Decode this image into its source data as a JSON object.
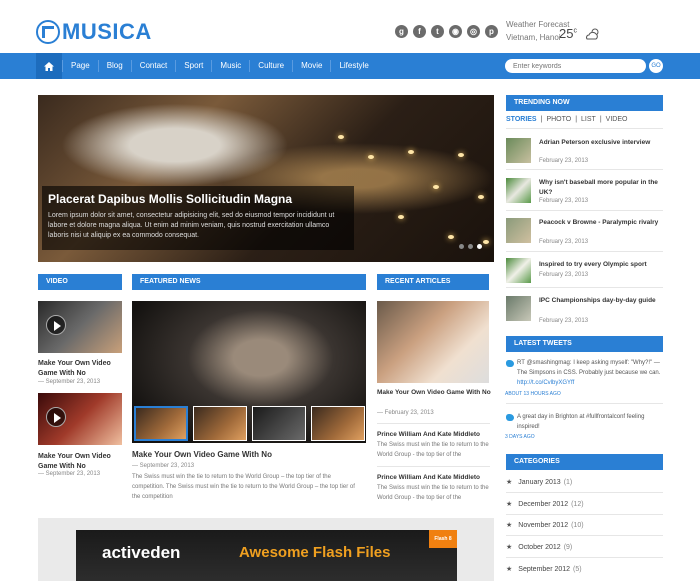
{
  "header": {
    "logo_text": "MUSICA",
    "social_icons": [
      "googleplus-icon",
      "facebook-icon",
      "twitter-icon",
      "rss-icon",
      "dribbble-icon",
      "pinterest-icon"
    ],
    "weather_label": "Weather Forecast",
    "weather_location": "Vietnam, Hanoi",
    "temperature": "25",
    "temperature_unit": "c"
  },
  "nav": {
    "items": [
      "Page",
      "Blog",
      "Contact",
      "Sport",
      "Music",
      "Culture",
      "Movie",
      "Lifestyle"
    ],
    "search_placeholder": "Enter keywords",
    "search_button": "GO"
  },
  "slider": {
    "title": "Placerat Dapibus Mollis Sollicitudin Magna",
    "description": "Lorem ipsum dolor sit amet, consectetur adipisicing elit, sed do eiusmod tempor incididunt ut labore et dolore magna aliqua. Ut enim ad minim veniam, quis nostrud exercitation ullamco laboris nisi ut aliquip ex ea commodo consequat.",
    "slide_count": 3,
    "active_slide": 3
  },
  "video": {
    "header": "VIDEO",
    "items": [
      {
        "title": "Make Your Own Video Game With No",
        "date": "— September 23, 2013"
      },
      {
        "title": "Make Your Own Video Game With No",
        "date": "— September 23, 2013"
      }
    ]
  },
  "featured": {
    "header": "FEATURED NEWS",
    "title": "Make Your Own Video Game With No",
    "date": "— September 23, 2013",
    "text": "The Swiss must win the tie to return to the World Group – the top tier of the competition. The Swiss must win the tie to return to the World Group – the top tier of the competition"
  },
  "recent": {
    "header": "RECENT ARTICLES",
    "items": [
      {
        "title": "Make Your Own Video Game With No",
        "date": "— February 23, 2013"
      },
      {
        "title": "Prince William And Kate Middleto",
        "text": "The Swiss must win the tie to return to the World Group - the top tier of the"
      },
      {
        "title": "Prince William And Kate Middleto",
        "text": "The Swiss must win the tie to return to the World Group - the top tier of the"
      }
    ]
  },
  "ad": {
    "brand": "activeden",
    "slogan": "Awesome Flash Files",
    "corner": "Flash 8"
  },
  "trending": {
    "header": "TRENDING NOW",
    "tabs": [
      "STORIES",
      "PHOTO",
      "LIST",
      "VIDEO"
    ],
    "items": [
      {
        "title": "Adrian Peterson exclusive interview",
        "date": "February 23, 2013"
      },
      {
        "title": "Why isn't baseball more popular in the UK?",
        "date": "February 23, 2013"
      },
      {
        "title": "Peacock v Browne - Paralympic rivalry",
        "date": "February 23, 2013"
      },
      {
        "title": "Inspired to try every Olympic sport",
        "date": "February 23, 2013"
      },
      {
        "title": "IPC Championships day-by-day guide",
        "date": "February 23, 2013"
      }
    ]
  },
  "tweets": {
    "header": "LATEST TWEETS",
    "items": [
      {
        "text": "RT @smashingmag: I keep asking myself: \"Why?!\" — The Simpsons in CSS. Probably just because we can.",
        "link": "http://t.co/CvlbyXGYff",
        "ago": "ABOUT 13 HOURS AGO"
      },
      {
        "text": "A great day in Brighton at #fullfrontalconf feeling inspired!",
        "link": "",
        "ago": "3 DAYS AGO"
      }
    ]
  },
  "categories": {
    "header": "CATEGORIES",
    "items": [
      {
        "label": "January 2013",
        "count": "(1)"
      },
      {
        "label": "December 2012",
        "count": "(12)"
      },
      {
        "label": "November 2012",
        "count": "(10)"
      },
      {
        "label": "October 2012",
        "count": "(9)"
      },
      {
        "label": "September 2012",
        "count": "(5)"
      }
    ]
  },
  "colors": {
    "accent": "#2a7fd4",
    "ad_orange": "#f0a020"
  }
}
